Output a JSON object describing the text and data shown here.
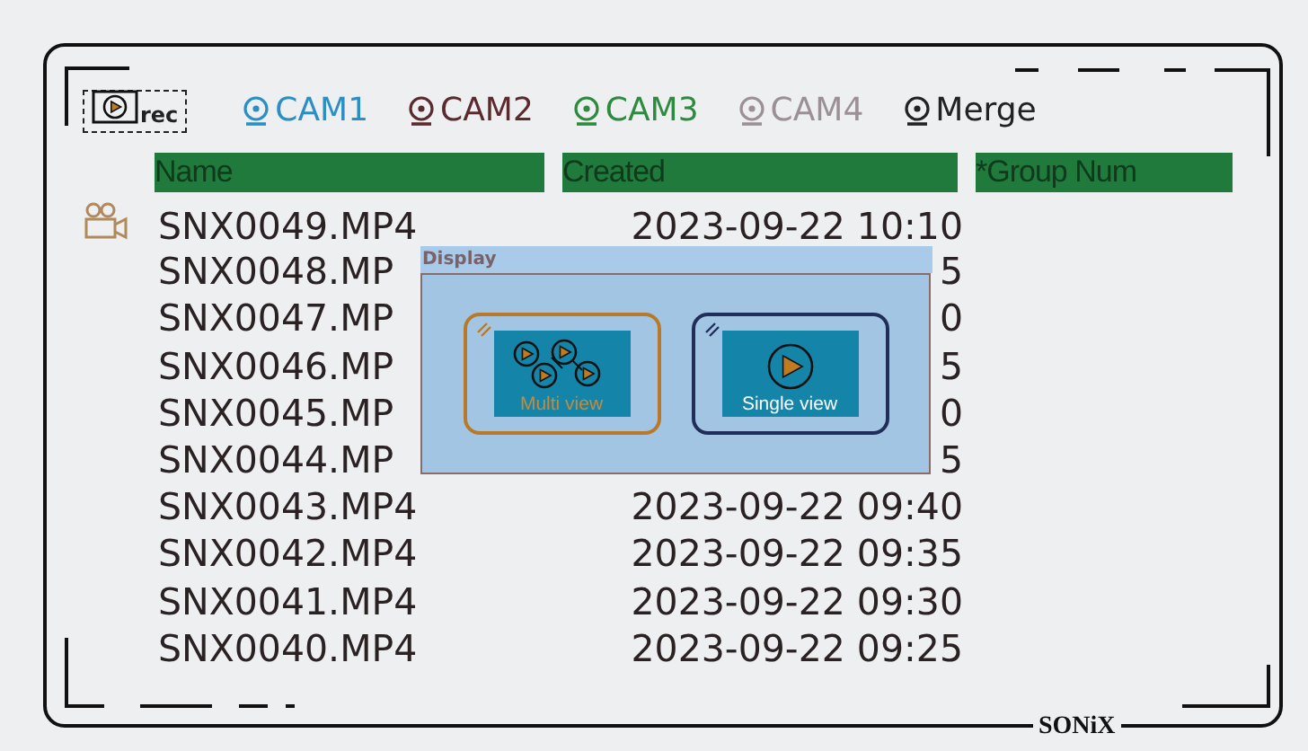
{
  "toolbar": {
    "rec_label": "rec",
    "tabs": [
      {
        "label": "CAM1",
        "color": "#2b8fc4",
        "selected": false
      },
      {
        "label": "CAM2",
        "color": "#5a2a2e",
        "selected": false
      },
      {
        "label": "CAM3",
        "color": "#2e8a3e",
        "selected": false
      },
      {
        "label": "CAM4",
        "color": "#9a9095",
        "selected": false
      },
      {
        "label": "Merge",
        "color": "#222222",
        "selected": false
      }
    ]
  },
  "table": {
    "columns": [
      "Name",
      "Created",
      "*Group Num"
    ],
    "rows": [
      {
        "name": "SNX0049.MP4",
        "created": "2023-09-22 10:10",
        "selected": true
      },
      {
        "name": "SNX0048.MP",
        "created": "5",
        "selected": false
      },
      {
        "name": "SNX0047.MP",
        "created": "0",
        "selected": false
      },
      {
        "name": "SNX0046.MP",
        "created": "5",
        "selected": false
      },
      {
        "name": "SNX0045.MP",
        "created": "0",
        "selected": false
      },
      {
        "name": "SNX0044.MP",
        "created": "5",
        "selected": false
      },
      {
        "name": "SNX0043.MP4",
        "created": "2023-09-22 09:40",
        "selected": false
      },
      {
        "name": "SNX0042.MP4",
        "created": "2023-09-22 09:35",
        "selected": false
      },
      {
        "name": "SNX0041.MP4",
        "created": "2023-09-22 09:30",
        "selected": false
      },
      {
        "name": "SNX0040.MP4",
        "created": "2023-09-22 09:25",
        "selected": false
      }
    ]
  },
  "dialog": {
    "title": "Display",
    "options": [
      {
        "label": "Multi view",
        "kind": "multi",
        "selected": true
      },
      {
        "label": "Single view",
        "kind": "single",
        "selected": false
      }
    ]
  },
  "logo": "SONiX"
}
